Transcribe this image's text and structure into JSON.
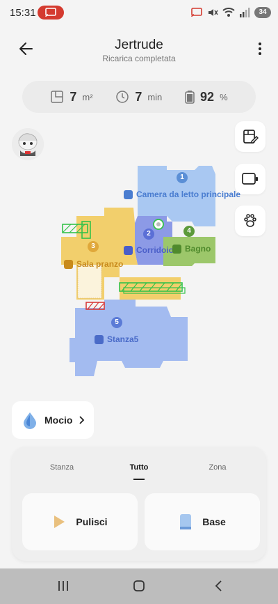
{
  "status": {
    "time": "15:31",
    "battery": "34"
  },
  "header": {
    "title": "Jertrude",
    "subtitle": "Ricarica completata"
  },
  "stats": [
    {
      "icon": "area-icon",
      "value": "7",
      "unit": "m²"
    },
    {
      "icon": "clock-icon",
      "value": "7",
      "unit": "min"
    },
    {
      "icon": "battery-icon",
      "value": "92",
      "unit": "%"
    }
  ],
  "rooms": [
    {
      "num": "1",
      "name": "Camera da letto principale",
      "color": "#5b8fd6"
    },
    {
      "num": "2",
      "name": "Corridoio",
      "color": "#5b6fd6"
    },
    {
      "num": "3",
      "name": "Sala pranzo",
      "color": "#d6a23a"
    },
    {
      "num": "4",
      "name": "Bagno",
      "color": "#5c9a3a"
    },
    {
      "num": "5",
      "name": "Stanza5",
      "color": "#5b7bd6"
    }
  ],
  "mode": {
    "label": "Mocio"
  },
  "tabs": [
    "Stanza",
    "Tutto",
    "Zona"
  ],
  "actions": {
    "clean": "Pulisci",
    "base": "Base"
  },
  "colors": {
    "bedroom": "#a9c8f2",
    "corridor": "#8c9ae6",
    "dining": "#f2cf6c",
    "bath": "#9cc76a",
    "room5": "#a3bbf0",
    "zone_green": "#35c24a",
    "zone_red": "#d83a3a"
  }
}
